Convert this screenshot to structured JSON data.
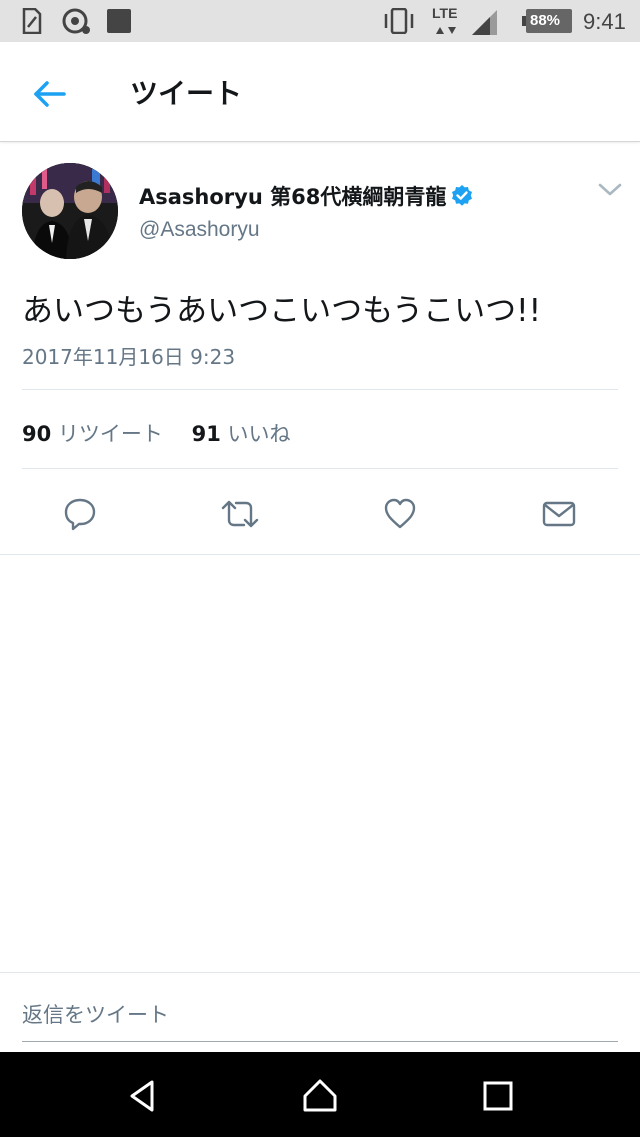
{
  "status_bar": {
    "network": "LTE",
    "battery": "88%",
    "time": "9:41",
    "icons": [
      "sim-card-icon",
      "share-icon",
      "square-notification-icon",
      "vibrate-icon",
      "data-arrows-icon",
      "signal-icon",
      "battery-icon"
    ]
  },
  "app_bar": {
    "title": "ツイート",
    "back_icon": "arrow-left-icon"
  },
  "tweet": {
    "display_name": "Asashoryu 第68代横綱朝青龍",
    "handle": "@Asashoryu",
    "verified": true,
    "text": "あいつもうあいつこいつもうこいつ!!",
    "timestamp": "2017年11月16日 9:23",
    "retweet_count": "90",
    "retweet_label": "リツイート",
    "like_count": "91",
    "like_label": "いいね"
  },
  "actions": [
    "reply-icon",
    "retweet-icon",
    "like-icon",
    "message-icon"
  ],
  "reply_bar": {
    "placeholder": "返信をツイート"
  },
  "nav_bar": {
    "buttons": [
      "back-triangle-icon",
      "home-circle-icon",
      "recents-square-icon"
    ]
  },
  "colors": {
    "accent": "#1da1f2",
    "text": "#14171a",
    "secondary_text": "#657786",
    "status_bar_bg": "#e1e2e1",
    "nav_bar_bg": "#000000"
  }
}
